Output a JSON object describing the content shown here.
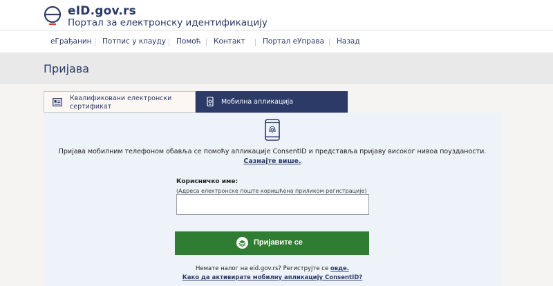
{
  "header": {
    "brand_title": "eID.gov.rs",
    "brand_subtitle": "Портал за електронску идентификацију",
    "logo_icon": "eid-logo-icon"
  },
  "nav": {
    "items": [
      {
        "label": "еГрађанин"
      },
      {
        "label": "Потпис у клауду"
      },
      {
        "label": "Помоћ"
      },
      {
        "label": "Контакт"
      },
      {
        "label": "Портал еУправа"
      },
      {
        "label": "Назад"
      }
    ]
  },
  "page": {
    "title": "Пријава"
  },
  "tabs": [
    {
      "label": "Квалификовани електронски сертификат",
      "icon": "id-card-icon",
      "active": false
    },
    {
      "label": "Мобилна апликација",
      "icon": "mobile-app-icon",
      "active": true
    }
  ],
  "panel": {
    "phone_icon": "phone-fingerprint-icon",
    "description": "Пријава мобилним телефоном обавља се помоћу апликације ConsentID и представља пријаву високог нивоа поузданости. ",
    "learn_more_link": "Сазнајте више.",
    "username_label": "Корисничко име:",
    "username_hint": "(Адреса електронске поште коришћена приликом регистрације)",
    "username_value": "",
    "login_button": "Пријавите се",
    "register_text": "Немате налог на eid.gov.rs? Региструјте се ",
    "register_link": "овде.",
    "activate_link": "Како да активирате мобилну апликацију ConsentID?"
  },
  "colors": {
    "brand_navy": "#2b3a67",
    "button_green": "#2e7d32",
    "panel_bg": "#eef3f9",
    "title_band_bg": "#e9e9e9"
  }
}
